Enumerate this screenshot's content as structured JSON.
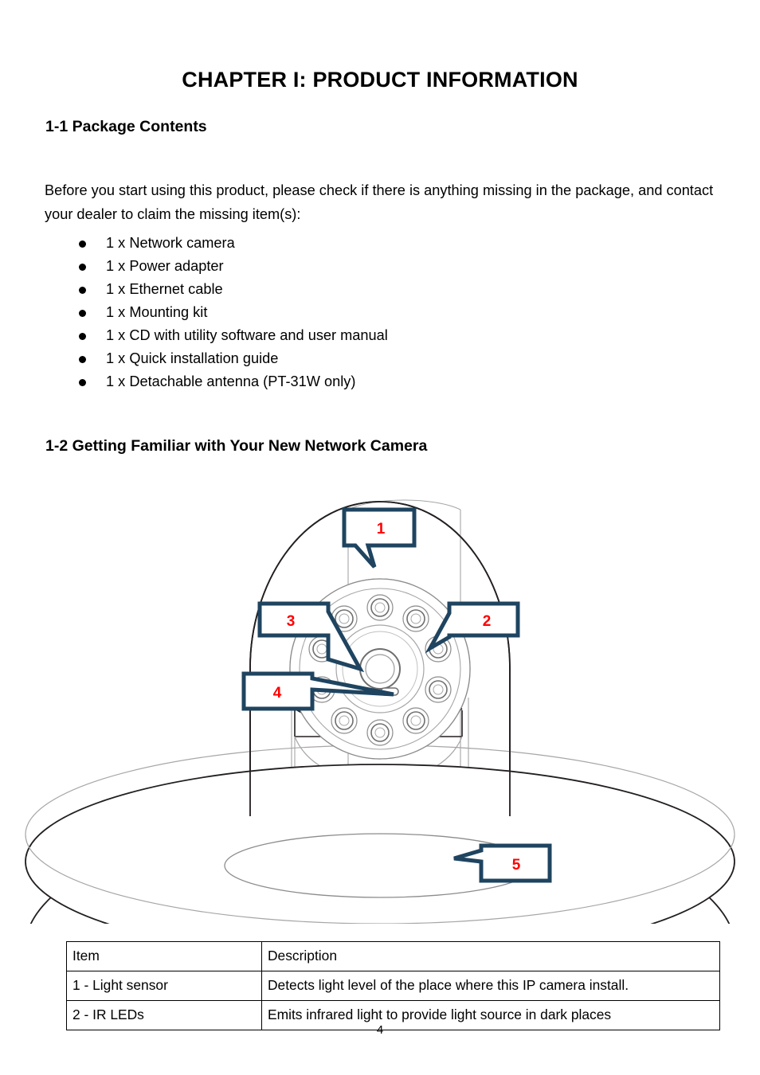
{
  "document": {
    "chapter_title": "CHAPTER I: PRODUCT INFORMATION",
    "page_number": "4"
  },
  "section_1_1": {
    "heading": "1-1 Package Contents",
    "intro": "Before you start using this product, please check if there is anything missing in the package, and contact your dealer to claim the missing item(s):",
    "items": [
      "1 x Network camera",
      "1 x Power adapter",
      "1 x Ethernet cable",
      "1 x Mounting kit",
      "1 x CD with utility software and user manual",
      "1 x Quick installation guide",
      "1 x Detachable antenna (PT-31W only)"
    ]
  },
  "section_1_2": {
    "heading": "1-2 Getting Familiar with Your New Network Camera",
    "figure": {
      "name": "network-camera-diagram",
      "callout_color": "#1F4460",
      "callout_number_color": "#FF0000",
      "outline_color": "#231F20",
      "callouts": [
        {
          "id": "1",
          "label": "1",
          "target": "ir-led-top"
        },
        {
          "id": "2",
          "label": "2",
          "target": "ir-led-right"
        },
        {
          "id": "3",
          "label": "3",
          "target": "lens"
        },
        {
          "id": "4",
          "label": "4",
          "target": "light-sensor"
        },
        {
          "id": "5",
          "label": "5",
          "target": "base-ring"
        }
      ]
    }
  },
  "spec_table": {
    "headers": [
      "Item",
      "Description"
    ],
    "rows": [
      [
        "1 - Light sensor",
        "Detects light level of the place where this IP camera install."
      ],
      [
        "2 - IR LEDs",
        "Emits infrared light to provide light source in dark places"
      ]
    ]
  }
}
